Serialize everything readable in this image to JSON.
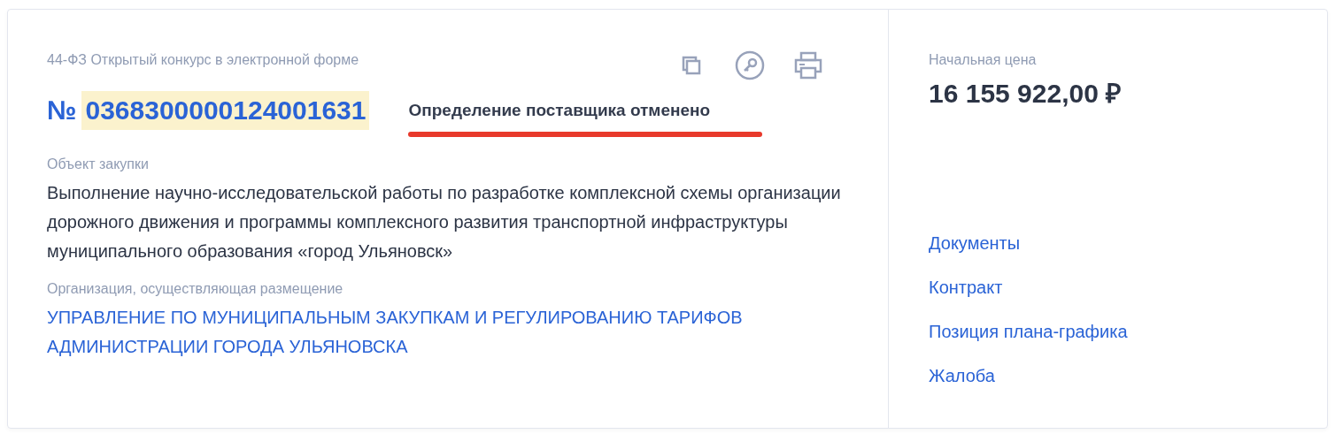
{
  "procurement_type": "44-ФЗ Открытый конкурс в электронной форме",
  "number_prefix": "№",
  "number": "0368300000124001631",
  "number_highlighted": true,
  "status": "Определение поставщика отменено",
  "status_underlined": true,
  "actions": [
    {
      "kind": "copy"
    },
    {
      "kind": "key"
    },
    {
      "kind": "print"
    }
  ],
  "object_label": "Объект закупки",
  "object_text": "Выполнение научно-исследовательской работы по разработке комплексной схемы организации дорожного движения и программы комплексного развития транспортной инфраструктуры муниципального образования «город Ульяновск»",
  "organization_label": "Организация, осуществляющая размещение",
  "organization": "УПРАВЛЕНИЕ ПО МУНИЦИПАЛЬНЫМ ЗАКУПКАМ И РЕГУЛИРОВАНИЮ ТАРИФОВ АДМИНИСТРАЦИИ ГОРОДА УЛЬЯНОВСКА",
  "price_label": "Начальная цена",
  "price": "16 155 922,00 ₽",
  "links": [
    "Документы",
    "Контракт",
    "Позиция плана-графика",
    "Жалоба"
  ]
}
